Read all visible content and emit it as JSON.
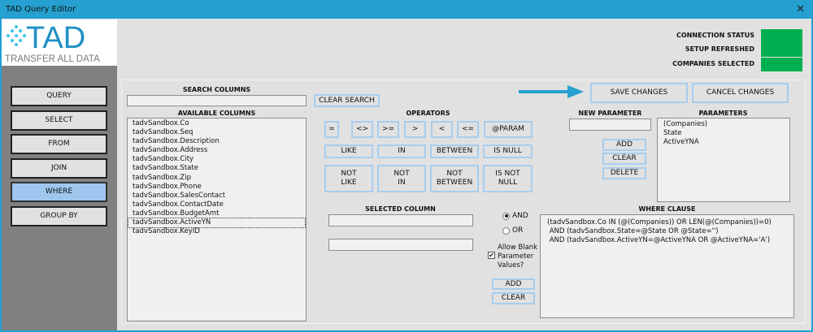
{
  "window": {
    "title": "TAD Query Editor",
    "close": "✕"
  },
  "logo": {
    "text": "TAD",
    "subtitle": "TRANSFER ALL DATA"
  },
  "sidebar": {
    "items": [
      {
        "label": "QUERY"
      },
      {
        "label": "SELECT"
      },
      {
        "label": "FROM"
      },
      {
        "label": "JOIN"
      },
      {
        "label": "WHERE",
        "active": true
      },
      {
        "label": "GROUP BY"
      }
    ]
  },
  "status": {
    "connection": "CONNECTION STATUS",
    "setup": "SETUP REFRESHED",
    "companies": "COMPANIES SELECTED",
    "color": "#00b050"
  },
  "search": {
    "label": "SEARCH COLUMNS",
    "value": "",
    "clear": "CLEAR SEARCH"
  },
  "available": {
    "label": "AVAILABLE COLUMNS",
    "items": [
      "tadvSandbox.Co",
      "tadvSandbox.Seq",
      "tadvSandbox.Description",
      "tadvSandbox.Address",
      "tadvSandbox.City",
      "tadvSandbox.State",
      "tadvSandbox.Zip",
      "tadvSandbox.Phone",
      "tadvSandbox.SalesContact",
      "tadvSandbox.ContactDate",
      "tadvSandbox.BudgetAmt",
      "tadvSandbox.ActiveYN",
      "tadvSandbox.KeyID"
    ],
    "focused_index": 11
  },
  "operators": {
    "label": "OPERATORS",
    "row1": [
      "=",
      "<>",
      ">=",
      ">",
      "<",
      "<=",
      "@PARAM"
    ],
    "row2": [
      "LIKE",
      "IN",
      "BETWEEN",
      "IS NULL"
    ],
    "row3": [
      [
        "NOT",
        "LIKE"
      ],
      [
        "NOT",
        "IN"
      ],
      [
        "NOT",
        "BETWEEN"
      ],
      [
        "IS NOT",
        "NULL"
      ]
    ]
  },
  "selected_column": {
    "label": "SELECTED COLUMN",
    "value1": "",
    "value2": ""
  },
  "logic": {
    "and": "AND",
    "or": "OR",
    "selected": "AND",
    "allow_blank": [
      "Allow Blank",
      "Parameter",
      "Values?"
    ],
    "allow_blank_checked": true,
    "add": "ADD",
    "clear": "CLEAR"
  },
  "actions": {
    "save": "SAVE CHANGES",
    "cancel": "CANCEL CHANGES"
  },
  "new_parameter": {
    "label": "NEW PARAMETER",
    "value": "",
    "add": "ADD",
    "clear": "CLEAR",
    "delete": "DELETE"
  },
  "parameters": {
    "label": "PARAMETERS",
    "items": [
      "(Companies)",
      "State",
      "ActiveYNA"
    ]
  },
  "where": {
    "label": "WHERE CLAUSE",
    "lines": [
      "(tadvSandbox.Co IN (@(Companies)) OR LEN(@(Companies))=0)",
      " AND (tadvSandbox.State=@State OR @State='')",
      " AND (tadvSandbox.ActiveYN=@ActiveYNA OR @ActiveYNA='A')"
    ]
  }
}
